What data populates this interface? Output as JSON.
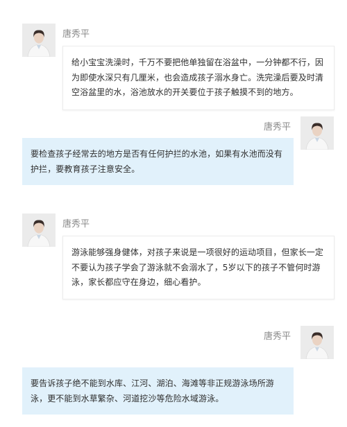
{
  "messages": [
    {
      "sender": "唐秀平",
      "side": "left",
      "style": "white",
      "text": "给小宝宝洗澡时，千万不要把他单独留在浴盆中，一分钟都不行，因为即使水深只有几厘米，也会造成孩子溺水身亡。洗完澡后要及时清空浴盆里的水，浴池放水的开关要位于孩子触摸不到的地方。"
    },
    {
      "sender": "唐秀平",
      "side": "right",
      "style": "blue",
      "text": "要检查孩子经常去的地方是否有任何护拦的水池，如果有水池而没有护拦，要教育孩子注意安全。"
    },
    {
      "sender": "唐秀平",
      "side": "left",
      "style": "white",
      "text": "游泳能够强身健体，对孩子来说是一项很好的运动项目，但家长一定不要认为孩子学会了游泳就不会溺水了，5岁以下的孩子不管何时游泳，家长都应守在身边，细心看护。"
    },
    {
      "sender": "唐秀平",
      "side": "right",
      "style": "blue",
      "text": "要告诉孩子绝不能到水库、江河、湖泊、海滩等非正规游泳场所游泳，更不能到水草繁杂、河道挖沙等危险水域游泳。"
    }
  ],
  "colors": {
    "name_text": "#8a8a8a",
    "bubble_text": "#2f2f2f",
    "blue_bubble": "#e1f1fb",
    "white_bubble_border": "#ececec",
    "avatar_bg": "#ebebeb",
    "avatar_coat": "#f7f7f7",
    "avatar_hair": "#3a2e2a"
  }
}
